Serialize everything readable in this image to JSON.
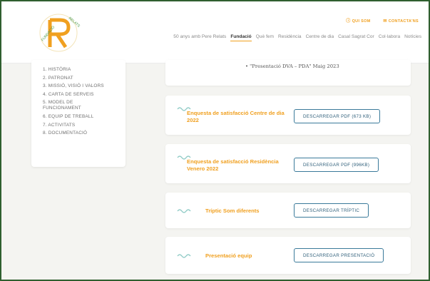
{
  "topbar": {
    "link1": "QUI SOM",
    "link2": "CONTACTA'NS"
  },
  "nav": [
    "50 anys amb Pere Relats",
    "Fundació",
    "Què fem",
    "Residència",
    "Centre de dia",
    "Casal Sagrat Cor",
    "Col·labora",
    "Notícies"
  ],
  "sidebar": [
    "1. HISTÒRIA",
    "2. PATRONAT",
    "3. MISSIÓ, VISIÓ I VALORS",
    "4. CARTA DE SERVEIS",
    "5. MODEL DE FUNCIONAMENT",
    "6. EQUIP DE TREBALL",
    "7. ACTIVITATS",
    "8. DOCUMENTACIÓ"
  ],
  "documents": {
    "presentation_line": "\"Presentació DVA – PDA\" Maig 2023",
    "cards": [
      {
        "title": "Enquesta de satisfacció Centre de dia 2022",
        "button": "DESCARREGAR PDF (673 KB)"
      },
      {
        "title": "Enquesta de satisfacció Residència Venero 2022",
        "button": "DESCARREGAR PDF (996KB)"
      },
      {
        "title": "Tríptic Som diferents",
        "button": "DESCARREGAR TRÍPTIC"
      },
      {
        "title": "Presentació equip",
        "button": "DESCARREGAR PRESENTACIÓ"
      }
    ]
  },
  "colors": {
    "accent": "#f0a020",
    "button_border": "#3a7a9a",
    "wave": "#8cc9c4"
  }
}
